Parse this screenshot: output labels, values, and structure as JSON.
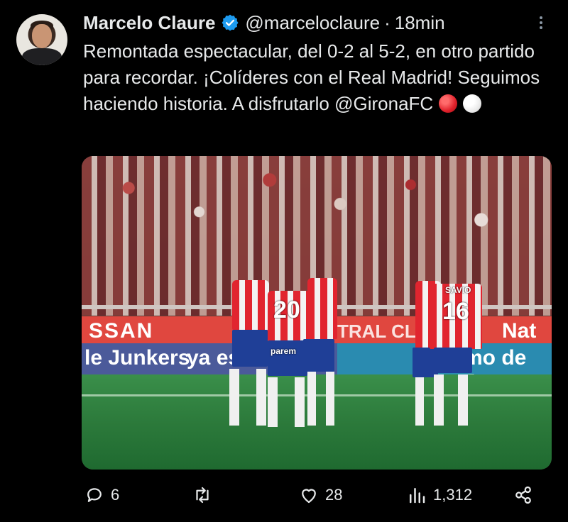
{
  "tweet": {
    "author_name": "Marcelo Claure",
    "handle": "@marceloclaure",
    "separator": "·",
    "timestamp": "18min",
    "text": "Remontada espectacular, del 0-2 al 5-2, en otro partido para recordar. ¡Colíderes con el Real Madrid! Seguimos haciendo historia. A disfrutarlo @GironaFC",
    "emojis": [
      "red-circle",
      "white-circle"
    ]
  },
  "photo": {
    "ad_top_left": "SSAN",
    "ad_top_mid": "TRAL CLIN",
    "ad_top_right": "Nat",
    "ad_bottom_left": "le Junkers",
    "ad_bottom_mid": "ya es",
    "ad_bottom_right": "mo de Jur",
    "jersey_numbers": [
      "20",
      "16"
    ],
    "player_name": "SAVIO",
    "sponsor": "parem"
  },
  "actions": {
    "replies": "6",
    "reposts": "",
    "likes": "28",
    "views": "1,312"
  },
  "colors": {
    "background": "#000000",
    "text": "#e7e9ea",
    "verified": "#1d9bf0",
    "muted": "#8b98a5"
  }
}
